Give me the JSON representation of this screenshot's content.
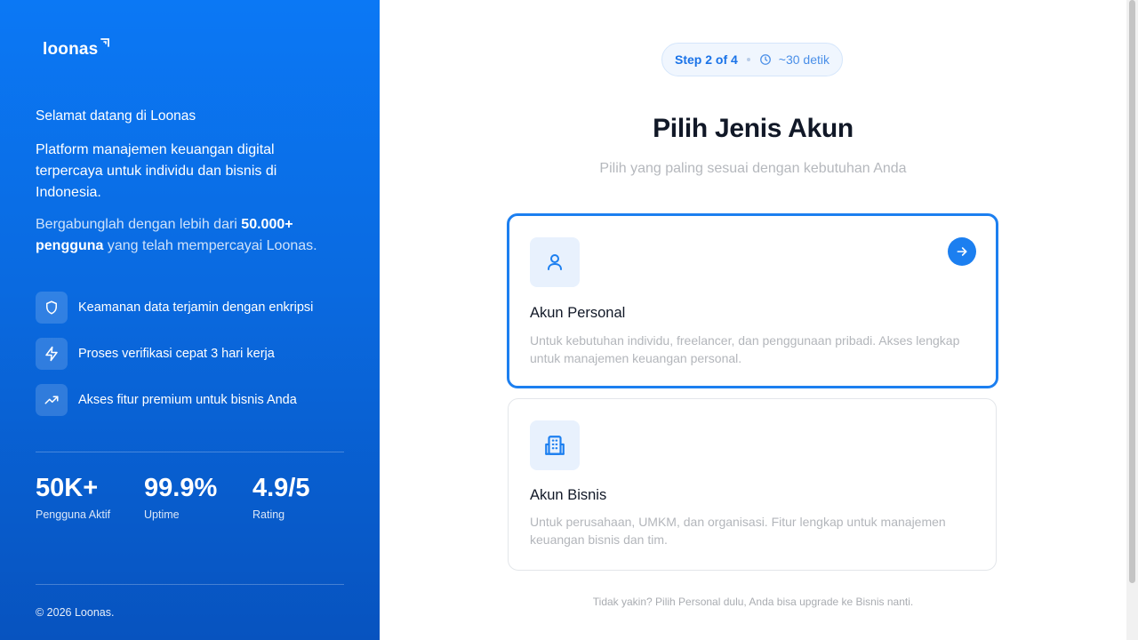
{
  "brand": {
    "name": "loonas"
  },
  "sidebar": {
    "welcome": "Selamat datang di Loonas",
    "description": "Platform manajemen keuangan digital terpercaya untuk individu dan bisnis di Indonesia.",
    "join_prefix": "Bergabunglah dengan lebih dari ",
    "join_highlight": "50.000+ pengguna",
    "join_suffix": " yang telah mempercayai Loonas.",
    "features": [
      {
        "icon": "shield-icon",
        "label": "Keamanan data terjamin dengan enkripsi"
      },
      {
        "icon": "lightning-icon",
        "label": "Proses verifikasi cepat 3 hari kerja"
      },
      {
        "icon": "trending-up-icon",
        "label": "Akses fitur premium untuk bisnis Anda"
      }
    ],
    "stats": [
      {
        "value": "50K+",
        "label": "Pengguna Aktif"
      },
      {
        "value": "99.9%",
        "label": "Uptime"
      },
      {
        "value": "4.9/5",
        "label": "Rating"
      }
    ],
    "footer": "© 2026 Loonas."
  },
  "main": {
    "step": "Step 2 of 4",
    "time": "~30 detik",
    "title": "Pilih Jenis Akun",
    "subtitle": "Pilih yang paling sesuai dengan kebutuhan Anda",
    "options": [
      {
        "icon": "user-icon",
        "title": "Akun Personal",
        "description": "Untuk kebutuhan individu, freelancer, dan penggunaan pribadi. Akses lengkap untuk manajemen keuangan personal.",
        "selected": true
      },
      {
        "icon": "building-icon",
        "title": "Akun Bisnis",
        "description": "Untuk perusahaan, UMKM, dan organisasi. Fitur lengkap untuk manajemen keuangan bisnis dan tim.",
        "selected": false
      }
    ],
    "hint": "Tidak yakin? Pilih Personal dulu, Anda bisa upgrade ke Bisnis nanti."
  },
  "colors": {
    "primary": "#1c7ff0",
    "sidebar_top": "#0b78f5",
    "sidebar_bottom": "#0753bf"
  }
}
